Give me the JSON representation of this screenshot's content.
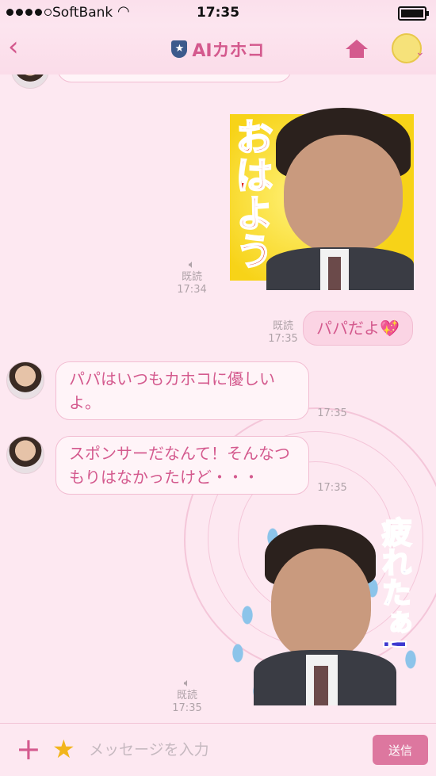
{
  "status_bar": {
    "carrier": "SoftBank",
    "time": "17:35",
    "signal_icon": "signal-dots-icon",
    "wifi_icon": "wifi-icon",
    "battery_icon": "battery-icon"
  },
  "header": {
    "title": "AIカホコ",
    "back_icon": "chevron-left-icon",
    "title_icon": "shield-star-icon",
    "home_icon": "home-icon",
    "mascot_icon": "mascot-avatar-icon",
    "dropdown_icon": "chevron-down-icon"
  },
  "messages": [
    {
      "id": "sticker-ohayo",
      "from": "me",
      "type": "sticker",
      "text": "おはよう",
      "read": "既読",
      "time": "17:34",
      "audio_icon": "speaker-icon"
    },
    {
      "id": "papadayo",
      "from": "me",
      "type": "text",
      "text": "パパだよ",
      "emoji": "💖",
      "read": "既読",
      "time": "17:35"
    },
    {
      "id": "msg-yasashii",
      "from": "kahoko",
      "type": "text",
      "text": "パパはいつもカホコに優しいよ。",
      "time": "17:35"
    },
    {
      "id": "msg-sponsor",
      "from": "kahoko",
      "type": "text",
      "text": "スポンサーだなんて！そんなつもりはなかったけど・・・",
      "time": "17:35"
    },
    {
      "id": "sticker-tsukareta",
      "from": "me",
      "type": "sticker",
      "text": "疲れたぁ!",
      "read": "既読",
      "time": "17:35",
      "audio_icon": "speaker-icon"
    }
  ],
  "input": {
    "placeholder": "メッセージを入力",
    "value": "",
    "send_label": "送信",
    "plus_icon": "plus-icon",
    "star_icon": "star-icon"
  },
  "colors": {
    "accent": "#d45a8e",
    "background": "#fde8f1",
    "send_button": "#dd779f",
    "star": "#f2b51c"
  }
}
